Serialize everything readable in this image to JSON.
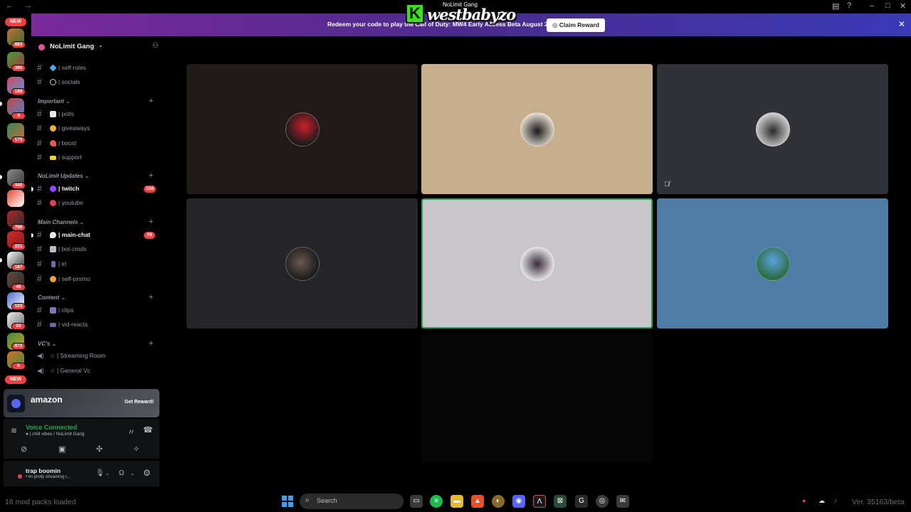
{
  "banner": {
    "text": "Redeem your code to play the Call of Duty: MW4 Early Access Beta August 21 – 25.",
    "button": "Claim Reward"
  },
  "watermark": {
    "logo_letter": "K",
    "name": "westbabyzo",
    "small": "NoLimit Gang"
  },
  "server": {
    "name": "NoLimit Gang",
    "chevron": "⌄"
  },
  "rail": {
    "new_label": "NEW",
    "badges": [
      "883",
      "390",
      "189",
      "4",
      "175",
      "440",
      "766",
      "221",
      "167",
      "45",
      "103",
      "53",
      "872",
      "5"
    ]
  },
  "categories": {
    "important": "Important ⌄",
    "updates": "NoLimit Updates ⌄",
    "main": "Main Channels ⌄",
    "content": "Content ⌄",
    "vcs": "VC's ⌄"
  },
  "channels": {
    "self_roles": "| self-roles",
    "socials": "| socials",
    "polls": "| polls",
    "giveaways": "| giveaways",
    "boost": "| boost",
    "support": "| support",
    "twitch": "| twitch",
    "twitch_badge": "108",
    "youtube": "| youtube",
    "main_chat": "| main-chat",
    "main_chat_badge": "29",
    "bot_cmds": "| bot-cmds",
    "irl": "| irl",
    "self_promo": "| self-promo",
    "clips": "| clips",
    "vid_reacts": "| vid-reacts",
    "streaming_room": "☆ | Streaming Room",
    "general_vc": "☆ | General Vc"
  },
  "promo": {
    "title": "amazon",
    "button": "Get Reward!"
  },
  "voice": {
    "status": "Voice Connected",
    "channel": "| chill vibes / NoLimit Gang"
  },
  "user": {
    "name": "trap boomin",
    "status": "• im prolly streaming r..."
  },
  "taskbar": {
    "overlay_text": "16 mod packs loaded",
    "search_placeholder": "Search",
    "version": "Ver. 35163/beta"
  },
  "colors": {
    "accent_green": "#23a55a",
    "badge_red": "#f23f43",
    "banner_start": "#7a2a9a",
    "banner_end": "#3a3ab8"
  }
}
